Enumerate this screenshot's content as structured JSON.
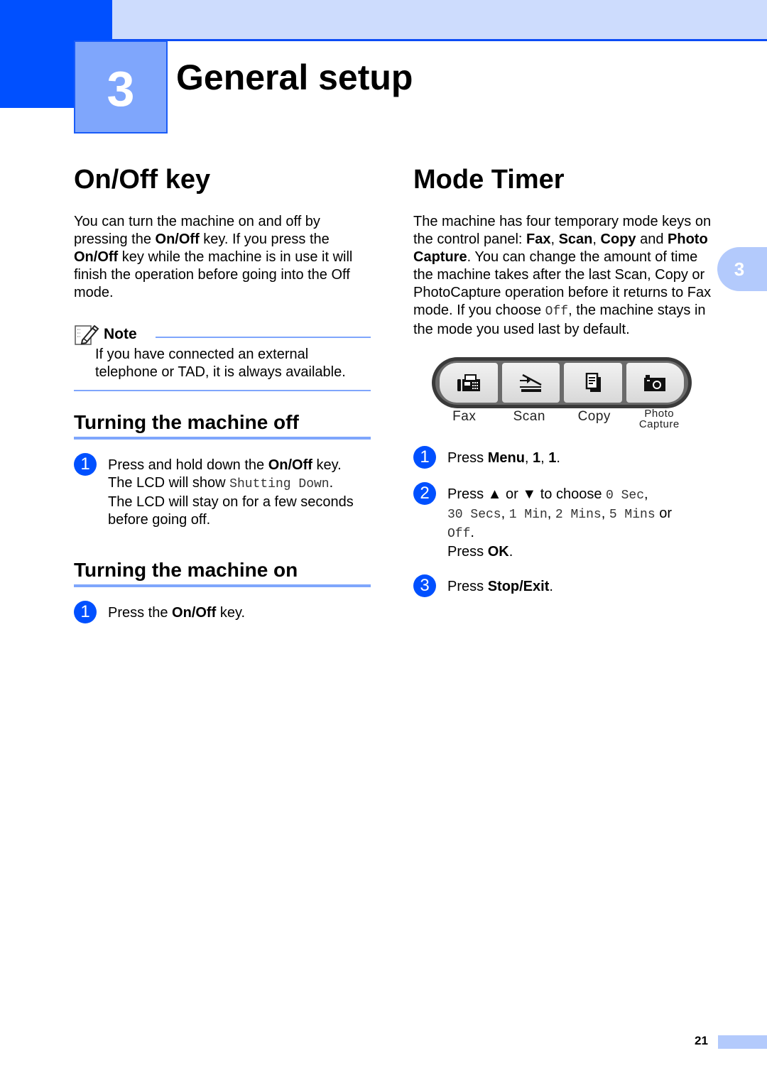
{
  "header": {
    "chapter_number": "3",
    "chapter_title": "General setup",
    "colors": {
      "primary": "#0050ff",
      "light": "#cddcfd",
      "accent": "#7fa6fc"
    }
  },
  "side_tab": {
    "label": "3"
  },
  "left": {
    "onoff": {
      "title": "On/Off key",
      "para": [
        {
          "t": "You can turn the machine on and off by pressing the "
        },
        {
          "b": "On/Off"
        },
        {
          "t": " key. If you press the "
        },
        {
          "b": "On/Off"
        },
        {
          "t": " key while the machine is in use it will finish the operation before going into the Off mode."
        }
      ]
    },
    "note": {
      "label": "Note",
      "icon": "note-pencil-icon",
      "text": "If you have connected an external telephone or TAD, it is always available."
    },
    "off_section": {
      "title": "Turning the machine off",
      "steps": [
        {
          "num": "1",
          "parts": [
            {
              "t": "Press and hold down the "
            },
            {
              "b": "On/Off"
            },
            {
              "t": " key."
            },
            {
              "br": true
            },
            {
              "t": "The LCD will show "
            },
            {
              "m": "Shutting Down"
            },
            {
              "t": "."
            },
            {
              "br": true
            },
            {
              "t": "The LCD will stay on for a few seconds before going off."
            }
          ]
        }
      ]
    },
    "on_section": {
      "title": "Turning the machine on",
      "steps": [
        {
          "num": "1",
          "parts": [
            {
              "t": "Press the "
            },
            {
              "b": "On/Off"
            },
            {
              "t": " key."
            }
          ]
        }
      ]
    }
  },
  "right": {
    "mode_timer": {
      "title": "Mode Timer",
      "para": [
        {
          "t": "The machine has four temporary mode keys on the control panel: "
        },
        {
          "b": "Fax"
        },
        {
          "t": ", "
        },
        {
          "b": "Scan"
        },
        {
          "t": ", "
        },
        {
          "b": "Copy"
        },
        {
          "t": " and "
        },
        {
          "b": "Photo Capture"
        },
        {
          "t": ". You can change the amount of time the machine takes after the last Scan, Copy or PhotoCapture operation before it returns to Fax mode. If you choose "
        },
        {
          "m": "Off"
        },
        {
          "t": ", the machine stays in the mode you used last by default."
        }
      ]
    },
    "panel": {
      "keys": [
        {
          "label": "Fax",
          "icon": "fax-icon"
        },
        {
          "label": "Scan",
          "icon": "scanner-icon"
        },
        {
          "label": "Copy",
          "icon": "copy-icon"
        },
        {
          "label": "Photo\nCapture",
          "icon": "camera-icon"
        }
      ]
    },
    "steps": [
      {
        "num": "1",
        "parts": [
          {
            "t": "Press "
          },
          {
            "b": "Menu"
          },
          {
            "t": ", "
          },
          {
            "b": "1"
          },
          {
            "t": ", "
          },
          {
            "b": "1"
          },
          {
            "t": "."
          }
        ]
      },
      {
        "num": "2",
        "parts": [
          {
            "t": "Press ▲ or ▼ to choose "
          },
          {
            "m": "0 Sec"
          },
          {
            "t": ", "
          },
          {
            "br": true
          },
          {
            "m": "30 Secs"
          },
          {
            "t": ", "
          },
          {
            "m": "1 Min"
          },
          {
            "t": ", "
          },
          {
            "m": "2 Mins"
          },
          {
            "t": ", "
          },
          {
            "m": "5 Mins"
          },
          {
            "t": " or "
          },
          {
            "br": true
          },
          {
            "m": "Off"
          },
          {
            "t": "."
          },
          {
            "br": true
          },
          {
            "t": "Press "
          },
          {
            "b": "OK"
          },
          {
            "t": "."
          }
        ]
      },
      {
        "num": "3",
        "parts": [
          {
            "t": "Press "
          },
          {
            "b": "Stop/Exit"
          },
          {
            "t": "."
          }
        ]
      }
    ]
  },
  "footer": {
    "page_number": "21"
  }
}
